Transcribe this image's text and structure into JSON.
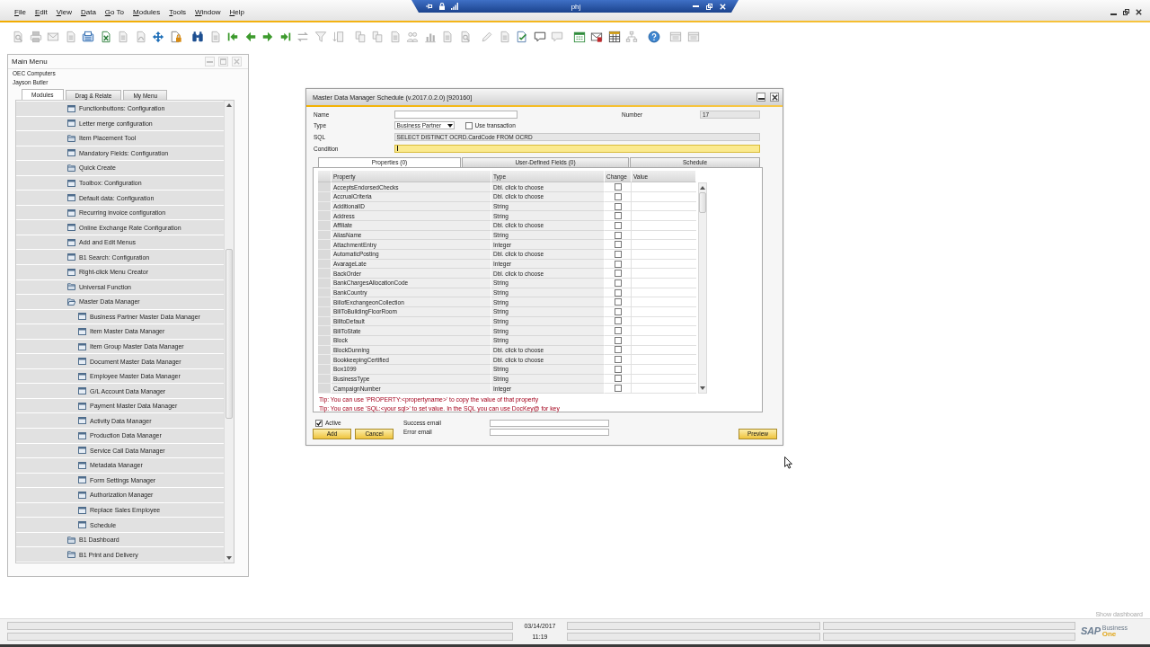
{
  "remote_bar": {
    "title": "phj"
  },
  "menu_bar": {
    "items": [
      "File",
      "Edit",
      "View",
      "Data",
      "Go To",
      "Modules",
      "Tools",
      "Window",
      "Help"
    ]
  },
  "toolbar": {
    "groups": [
      {
        "buttons": [
          {
            "kind": "preview",
            "disabled": true
          },
          {
            "kind": "print",
            "disabled": true
          },
          {
            "kind": "email",
            "disabled": true
          },
          {
            "kind": "document",
            "disabled": true
          },
          {
            "kind": "fax",
            "disabled": false
          },
          {
            "kind": "spreadsheet",
            "disabled": false
          },
          {
            "kind": "text_document",
            "disabled": true
          },
          {
            "kind": "pdf",
            "disabled": true
          },
          {
            "kind": "move",
            "disabled": false
          },
          {
            "kind": "lock",
            "disabled": false
          }
        ]
      },
      {
        "buttons": [
          {
            "kind": "find",
            "disabled": false
          },
          {
            "kind": "list",
            "disabled": true
          },
          {
            "kind": "first",
            "disabled": false
          },
          {
            "kind": "previous",
            "disabled": false
          },
          {
            "kind": "next",
            "disabled": false
          },
          {
            "kind": "last",
            "disabled": false
          },
          {
            "kind": "refresh",
            "disabled": true
          },
          {
            "kind": "filter",
            "disabled": true
          },
          {
            "kind": "sort",
            "disabled": true
          }
        ]
      },
      {
        "buttons": [
          {
            "kind": "copy",
            "disabled": true
          },
          {
            "kind": "copy",
            "disabled": true
          },
          {
            "kind": "document",
            "disabled": true
          },
          {
            "kind": "people",
            "disabled": true
          },
          {
            "kind": "chart",
            "disabled": true
          },
          {
            "kind": "list",
            "disabled": true
          },
          {
            "kind": "preview",
            "disabled": true
          }
        ]
      },
      {
        "buttons": [
          {
            "kind": "pen",
            "disabled": true
          },
          {
            "kind": "document",
            "disabled": true
          },
          {
            "kind": "edit",
            "disabled": false
          },
          {
            "kind": "message",
            "disabled": false
          },
          {
            "kind": "message",
            "disabled": true
          }
        ]
      },
      {
        "buttons": [
          {
            "kind": "calendar",
            "disabled": false
          },
          {
            "kind": "alert",
            "disabled": false
          },
          {
            "kind": "table",
            "disabled": false
          },
          {
            "kind": "tree",
            "disabled": true
          }
        ]
      },
      {
        "buttons": [
          {
            "kind": "help",
            "disabled": false
          }
        ]
      },
      {
        "buttons": [
          {
            "kind": "form",
            "disabled": true
          },
          {
            "kind": "form",
            "disabled": true
          }
        ]
      }
    ]
  },
  "main_menu": {
    "title": "Main Menu",
    "company": "OEC Computers",
    "user": "Jayson Butler",
    "tabs": [
      {
        "label": "Modules",
        "selected": true
      },
      {
        "label": "Drag & Relate",
        "selected": false
      },
      {
        "label": "My Menu",
        "selected": false
      }
    ],
    "items": [
      {
        "label": "Functionbuttons: Configuration",
        "kind": "form"
      },
      {
        "label": "Letter merge configuration",
        "kind": "form"
      },
      {
        "label": "Item Placement Tool",
        "kind": "folder",
        "expanded": false
      },
      {
        "label": "Mandatory Fields: Configuration",
        "kind": "form"
      },
      {
        "label": "Quick Create",
        "kind": "folder",
        "expanded": false
      },
      {
        "label": "Toolbox: Configuration",
        "kind": "form"
      },
      {
        "label": "Default data: Configuration",
        "kind": "form"
      },
      {
        "label": "Recurring invoice configuration",
        "kind": "form"
      },
      {
        "label": "Online Exchange Rate Configuration",
        "kind": "form"
      },
      {
        "label": "Add and Edit Menus",
        "kind": "form"
      },
      {
        "label": "B1 Search: Configuration",
        "kind": "form"
      },
      {
        "label": "Right-click Menu Creator",
        "kind": "form"
      },
      {
        "label": "Universal Function",
        "kind": "folder",
        "expanded": false
      },
      {
        "label": "Master Data Manager",
        "kind": "folder",
        "expanded": true,
        "children": [
          {
            "label": "Business Partner Master Data Manager",
            "kind": "form"
          },
          {
            "label": "Item Master Data Manager",
            "kind": "form"
          },
          {
            "label": "Item Group Master Data Manager",
            "kind": "form"
          },
          {
            "label": "Document Master Data Manager",
            "kind": "form"
          },
          {
            "label": "Employee Master Data Manager",
            "kind": "form"
          },
          {
            "label": "G/L Account Data Manager",
            "kind": "form"
          },
          {
            "label": "Payment Master Data Manager",
            "kind": "form"
          },
          {
            "label": "Activity Data Manager",
            "kind": "form"
          },
          {
            "label": "Production Data Manager",
            "kind": "form"
          },
          {
            "label": "Service Call Data Manager",
            "kind": "form"
          },
          {
            "label": "Metadata Manager",
            "kind": "form"
          },
          {
            "label": "Form Settings Manager",
            "kind": "form"
          },
          {
            "label": "Authorization Manager",
            "kind": "form"
          },
          {
            "label": "Replace Sales Employee",
            "kind": "form"
          },
          {
            "label": "Schedule",
            "kind": "form"
          }
        ]
      },
      {
        "label": "B1 Dashboard",
        "kind": "folder",
        "expanded": false
      },
      {
        "label": "B1 Print and Delivery",
        "kind": "folder",
        "expanded": false
      }
    ]
  },
  "dialog": {
    "title": "Master Data Manager Schedule (v.2017.0.2.0) [920160]",
    "name_field": {
      "label": "Name",
      "read_only": false
    },
    "number": {
      "label": "Number",
      "value": "17",
      "read_only": true
    },
    "type": {
      "label": "Type",
      "value": "Business Partner"
    },
    "use_transaction": {
      "label": "Use transaction",
      "checked": false
    },
    "sql": {
      "label": "SQL",
      "value": "SELECT DISTINCT OCRD.CardCode FROM OCRD",
      "read_only": true
    },
    "condition": {
      "label": "Condition",
      "focused": true
    },
    "tabs": [
      {
        "label": "Properties (0)",
        "selected": true
      },
      {
        "label": "User-Defined Fields (0)",
        "selected": false
      },
      {
        "label": "Schedule",
        "selected": false
      }
    ],
    "table": {
      "columns": [
        "Property",
        "Type",
        "Change",
        "Value"
      ],
      "rows": [
        {
          "property": "AcceptsEndorsedChecks",
          "type": "Dbl. click to choose",
          "change": false
        },
        {
          "property": "AccrualCriteria",
          "type": "Dbl. click to choose",
          "change": false
        },
        {
          "property": "AdditionalID",
          "type": "String",
          "change": false
        },
        {
          "property": "Address",
          "type": "String",
          "change": false
        },
        {
          "property": "Affiliate",
          "type": "Dbl. click to choose",
          "change": false
        },
        {
          "property": "AliasName",
          "type": "String",
          "change": false
        },
        {
          "property": "AttachmentEntry",
          "type": "Integer",
          "change": false
        },
        {
          "property": "AutomaticPosting",
          "type": "Dbl. click to choose",
          "change": false
        },
        {
          "property": "AvarageLate",
          "type": "Integer",
          "change": false
        },
        {
          "property": "BackOrder",
          "type": "Dbl. click to choose",
          "change": false
        },
        {
          "property": "BankChargesAllocationCode",
          "type": "String",
          "change": false
        },
        {
          "property": "BankCountry",
          "type": "String",
          "change": false
        },
        {
          "property": "BillofExchangeonCollection",
          "type": "String",
          "change": false
        },
        {
          "property": "BillToBuildingFloorRoom",
          "type": "String",
          "change": false
        },
        {
          "property": "BilltoDefault",
          "type": "String",
          "change": false
        },
        {
          "property": "BillToState",
          "type": "String",
          "change": false
        },
        {
          "property": "Block",
          "type": "String",
          "change": false
        },
        {
          "property": "BlockDunning",
          "type": "Dbl. click to choose",
          "change": false
        },
        {
          "property": "BookkeepingCertified",
          "type": "Dbl. click to choose",
          "change": false
        },
        {
          "property": "Box1099",
          "type": "String",
          "change": false
        },
        {
          "property": "BusinessType",
          "type": "String",
          "change": false
        },
        {
          "property": "CampaignNumber",
          "type": "Integer",
          "change": false
        }
      ]
    },
    "tips": [
      "Tip: You can use 'PROPERTY:<propertyname>' to copy the value of that property",
      "Tip: You can use 'SQL:<your sql>' to set value. In the SQL you can use DocKey@ for key"
    ],
    "active": {
      "label": "Active",
      "checked": true
    },
    "success_email": {
      "label": "Success email"
    },
    "error_email": {
      "label": "Error email"
    },
    "actions": [
      "Add",
      "Cancel"
    ],
    "preview": "Preview"
  },
  "dashboard_link": {
    "label": "Show dashboard"
  },
  "status_bar": {
    "date": "03/14/2017",
    "time": "11:19",
    "logo": {
      "wordmark": "SAP",
      "line_1": "Business",
      "line_2": "One"
    }
  }
}
